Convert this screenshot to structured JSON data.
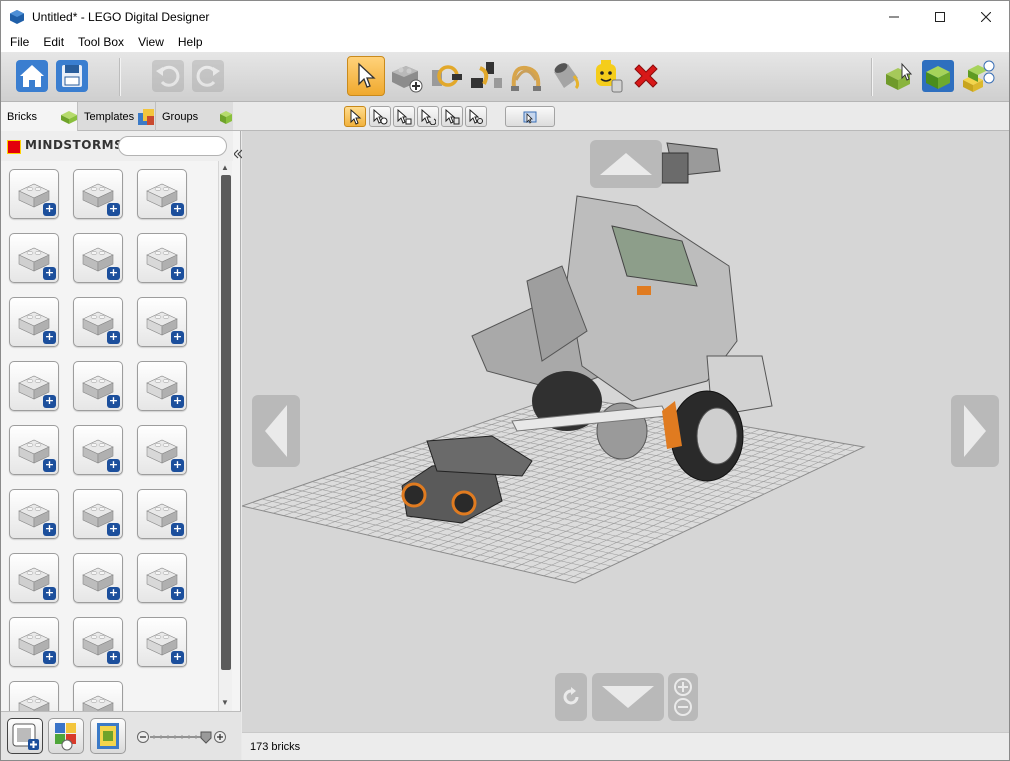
{
  "window": {
    "title": "Untitled* - LEGO Digital Designer"
  },
  "menu": [
    "File",
    "Edit",
    "Tool Box",
    "View",
    "Help"
  ],
  "toolbar": {
    "left": [
      {
        "name": "home-icon"
      },
      {
        "name": "save-icon"
      },
      {
        "name": "undo-icon"
      },
      {
        "name": "redo-icon"
      }
    ],
    "tools": [
      {
        "name": "select-tool-icon",
        "active": true
      },
      {
        "name": "clone-tool-icon"
      },
      {
        "name": "hinge-tool-icon"
      },
      {
        "name": "hinge-align-tool-icon"
      },
      {
        "name": "flex-tool-icon"
      },
      {
        "name": "paint-bucket-icon"
      },
      {
        "name": "decoration-tool-icon"
      },
      {
        "name": "delete-tool-icon"
      }
    ],
    "modes": [
      {
        "name": "build-mode-icon"
      },
      {
        "name": "view-mode-icon"
      },
      {
        "name": "building-guide-mode-icon"
      }
    ]
  },
  "palette_tabs": [
    {
      "label": "Bricks",
      "active": true
    },
    {
      "label": "Templates"
    },
    {
      "label": "Groups"
    }
  ],
  "palette": {
    "brand": "MINDSTORMS",
    "search_placeholder": "",
    "brick_count": 26
  },
  "select_modes": [
    "single-select-icon",
    "multi-select-icon",
    "connected-select-icon",
    "same-color-select-icon",
    "same-shape-select-icon",
    "same-color-shape-select-icon",
    "hide-selection-icon"
  ],
  "status": {
    "bricks": "173 bricks"
  },
  "colors": {
    "accent": "#f2b23d",
    "viewport": "#d6d6d6"
  }
}
